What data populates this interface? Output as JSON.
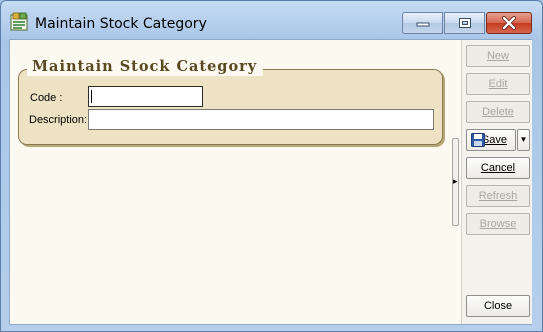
{
  "window": {
    "title": "Maintain Stock Category"
  },
  "form": {
    "group_title": "Maintain Stock Category",
    "code_label": "Code :",
    "code_value": "",
    "description_label": "Description:",
    "description_value": ""
  },
  "toolbar": {
    "new_label": "New",
    "edit_label": "Edit",
    "delete_label": "Delete",
    "save_label": "Save",
    "cancel_label": "Cancel",
    "refresh_label": "Refresh",
    "browse_label": "Browse",
    "close_label": "Close"
  },
  "colors": {
    "client_background": "#fcf9f1",
    "groupbox_fill": "#ede2c4",
    "group_title_text": "#5a4a22",
    "disabled_text": "#a9a79f"
  },
  "icons": {
    "app": "app-category-icon",
    "save": "floppy-disk-icon",
    "dropdown": "chevron-down-icon",
    "splitter": "chevron-right-icon"
  }
}
